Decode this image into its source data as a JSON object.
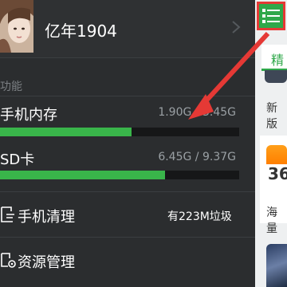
{
  "profile": {
    "username": "亿年1904"
  },
  "section": {
    "label": "功能"
  },
  "storage": [
    {
      "label": "手机内存",
      "value": "1.90G / 3.45G",
      "fill_percent": 55
    },
    {
      "label": "SD卡",
      "value": "6.45G / 9.37G",
      "fill_percent": 69
    }
  ],
  "tools": [
    {
      "label": "手机清理",
      "info": "有223M垃圾",
      "icon": "broom-icon"
    },
    {
      "label": "资源管理",
      "info": "",
      "icon": "gear-folder-icon"
    }
  ],
  "main": {
    "tab_label": "精",
    "news_label": "新版",
    "app_number": "36",
    "list_label": "海量"
  },
  "colors": {
    "accent": "#39b54a",
    "annotation": "#e53935"
  }
}
